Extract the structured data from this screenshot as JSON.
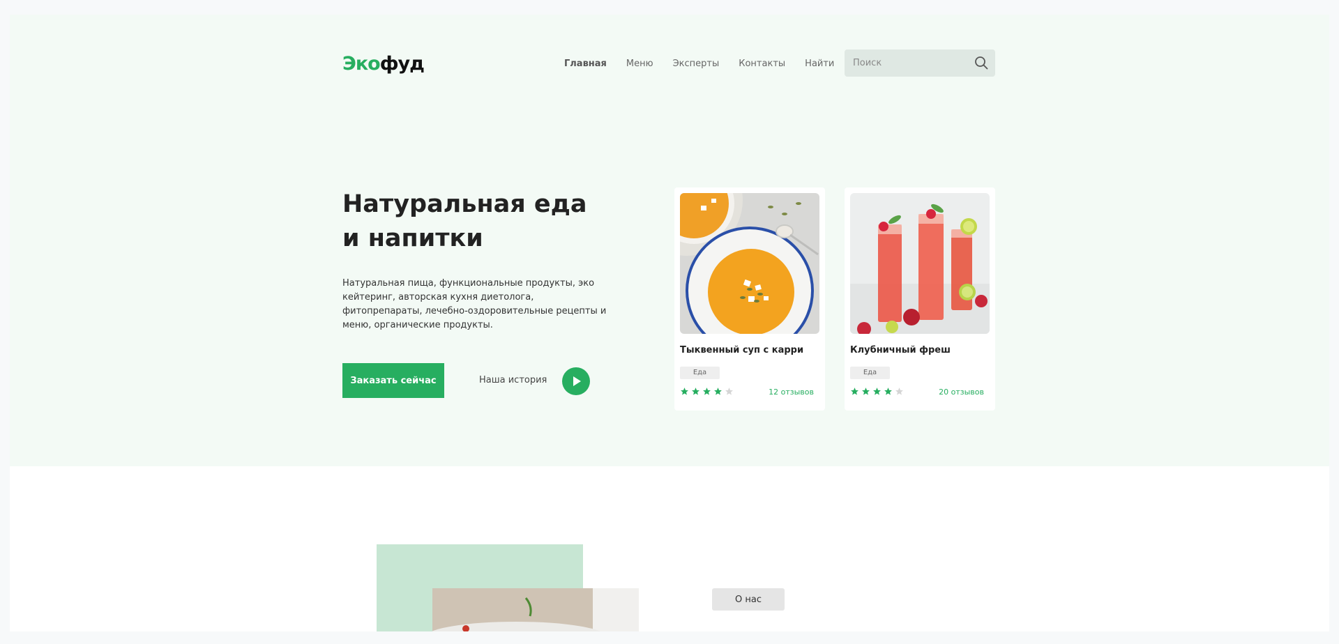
{
  "brand": {
    "part1": "Эко",
    "part2": "фуд",
    "accent": "#27ae60"
  },
  "nav": {
    "items": [
      {
        "label": "Главная",
        "active": true
      },
      {
        "label": "Меню"
      },
      {
        "label": "Эксперты"
      },
      {
        "label": "Контакты"
      },
      {
        "label": "Найти"
      }
    ]
  },
  "search": {
    "placeholder": "Поиск",
    "icon": "search-icon"
  },
  "hero": {
    "title_line1": "Натуральная еда",
    "title_line2": "и напитки",
    "text": "Натуральная пища, функциональные продукты, эко кейтеринг, авторская кухня диетолога, фитопрепараты, лечебно-оздоровительные рецепты и меню, органические продукты.",
    "order_button": "Заказать сейчас",
    "story_link": "Наша история",
    "play_icon": "play-icon"
  },
  "cards": [
    {
      "name": "Тыквенный суп с карри",
      "tag": "Еда",
      "rating": 4,
      "rating_max": 5,
      "reviews": "12 отзывов"
    },
    {
      "name": "Клубничный фреш",
      "tag": "Еда",
      "rating": 4,
      "rating_max": 5,
      "reviews": "20 отзывов"
    }
  ],
  "about": {
    "button": "О нас"
  },
  "colors": {
    "star_filled": "#27ae60",
    "star_empty": "#d5d5d5",
    "hero_bg": "#f3faf5",
    "green_block": "#c7e6d3"
  }
}
